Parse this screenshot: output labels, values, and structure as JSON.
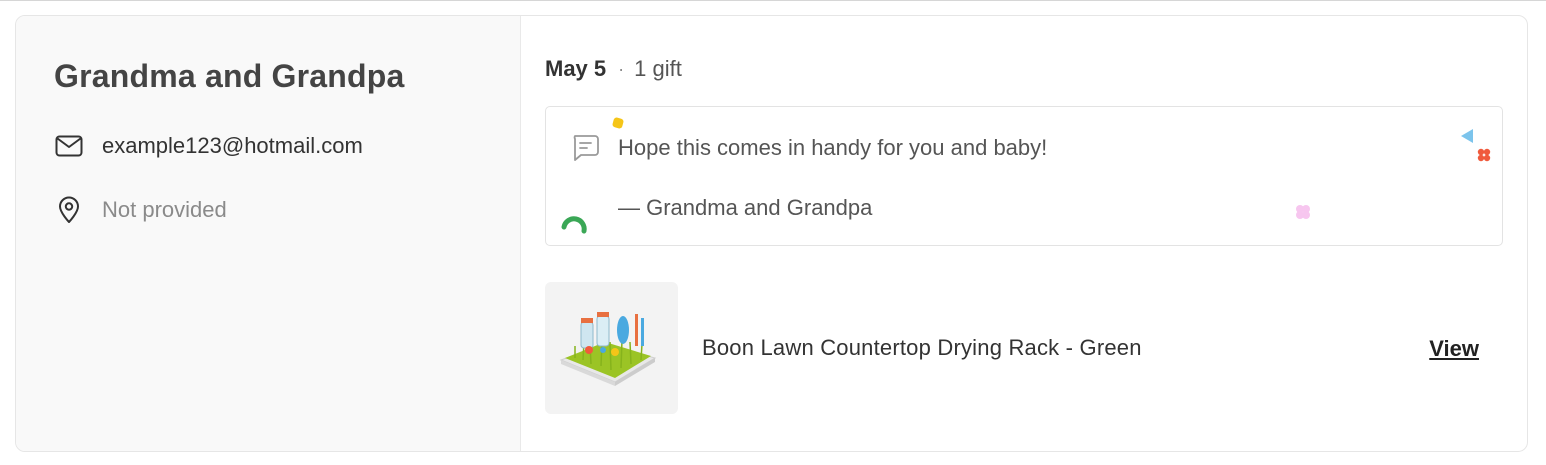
{
  "contact": {
    "name": "Grandma and Grandpa",
    "email": "example123@hotmail.com",
    "location": "Not provided",
    "email_icon": "mail-icon",
    "location_icon": "location-pin-icon"
  },
  "summary": {
    "date": "May 5",
    "separator": "·",
    "gift_count": "1 gift"
  },
  "message": {
    "icon": "message-icon",
    "text": "Hope this comes in handy for you and baby!",
    "signature": "— Grandma and Grandpa"
  },
  "gift": {
    "name": "Boon Lawn Countertop Drying Rack - Green",
    "action_label": "View",
    "image": "drying-rack-product-image"
  },
  "colors": {
    "confetti_yellow": "#f5c518",
    "confetti_blue": "#7cc4ec",
    "confetti_red": "#f05a3c",
    "confetti_pink": "#f7c6ef",
    "confetti_green": "#3aa756"
  }
}
